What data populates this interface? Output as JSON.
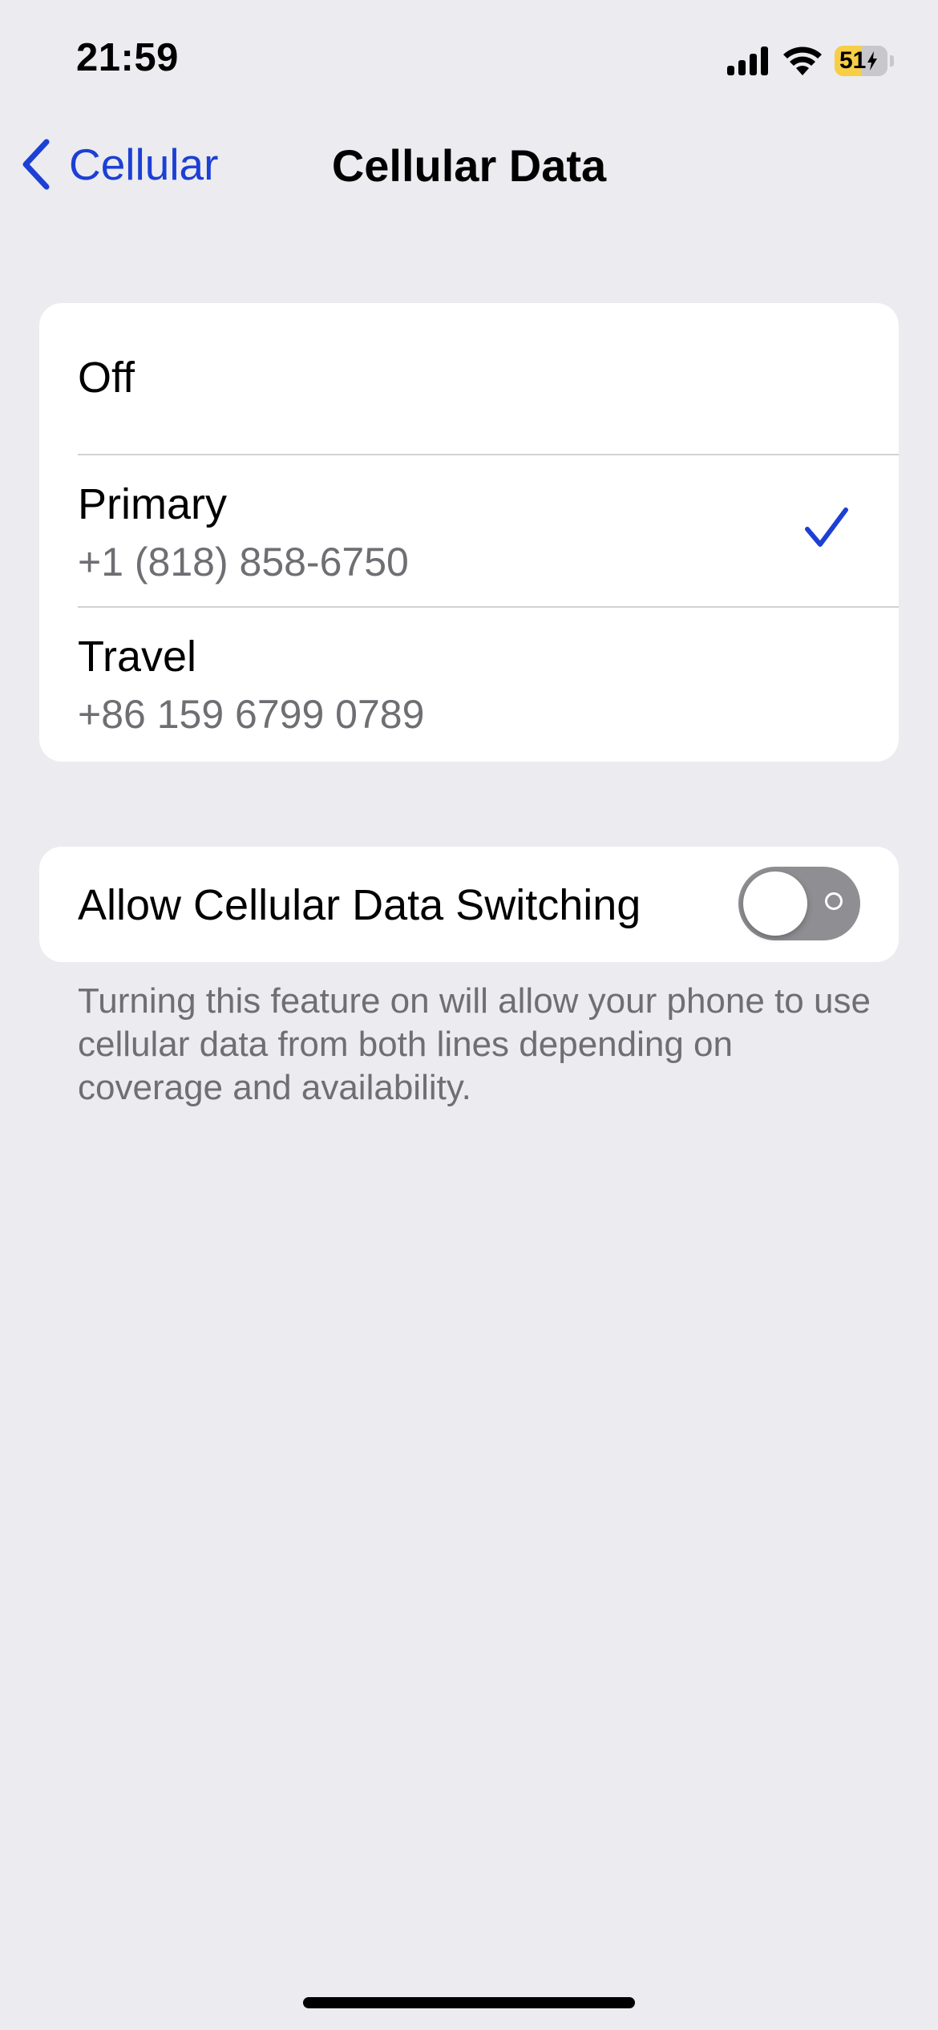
{
  "status_bar": {
    "time": "21:59",
    "battery_percent": "51",
    "battery_level": 0.51,
    "charging": true,
    "icons": [
      "signal-icon",
      "wifi-icon",
      "bolt-icon"
    ]
  },
  "nav": {
    "back_label": "Cellular",
    "title": "Cellular Data",
    "back_icon": "chevron-left-icon"
  },
  "lines": {
    "options": [
      {
        "title": "Off",
        "subtitle": "",
        "selected": false
      },
      {
        "title": "Primary",
        "subtitle": "+1 (818) 858-6750",
        "selected": true
      },
      {
        "title": "Travel",
        "subtitle": "+86 159 6799 0789",
        "selected": false
      }
    ]
  },
  "switching": {
    "label": "Allow Cellular Data Switching",
    "enabled": false,
    "footer": "Turning this feature on will allow your phone to use cellular data from both lines depending on coverage and availability."
  },
  "colors": {
    "accent": "#1c3fd4",
    "background": "#ebebf0",
    "toggle_off": "#8e8e93",
    "battery_charging": "#f7ce46"
  }
}
